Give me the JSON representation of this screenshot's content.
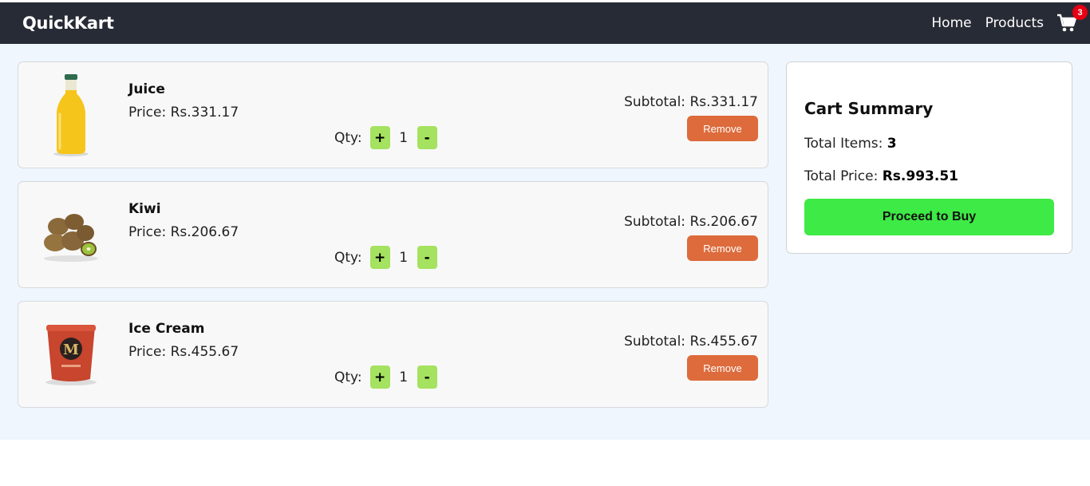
{
  "navbar": {
    "brand": "QuickKart",
    "links": [
      "Home",
      "Products"
    ],
    "cart_count": "3"
  },
  "cart": {
    "qty_label": "Qty:",
    "plus_label": "+",
    "minus_label": "-",
    "remove_label": "Remove",
    "items": [
      {
        "name": "Juice",
        "price": "Price: Rs.331.17",
        "qty": "1",
        "subtotal": "Subtotal: Rs.331.17",
        "image": "juice-bottle"
      },
      {
        "name": "Kiwi",
        "price": "Price: Rs.206.67",
        "qty": "1",
        "subtotal": "Subtotal: Rs.206.67",
        "image": "kiwi-fruit"
      },
      {
        "name": "Ice Cream",
        "price": "Price: Rs.455.67",
        "qty": "1",
        "subtotal": "Subtotal: Rs.455.67",
        "image": "ice-cream-tub"
      }
    ]
  },
  "summary": {
    "title": "Cart Summary",
    "total_items_label": "Total Items:",
    "total_items": "3",
    "total_price_label": "Total Price:",
    "total_price": "Rs.993.51",
    "buy_label": "Proceed to Buy"
  },
  "colors": {
    "navbar": "#272b35",
    "page_bg": "#eff6fd",
    "qty_button": "#a4e260",
    "remove_button": "#dd6b3c",
    "buy_button": "#3eea45",
    "badge": "#e60012"
  }
}
